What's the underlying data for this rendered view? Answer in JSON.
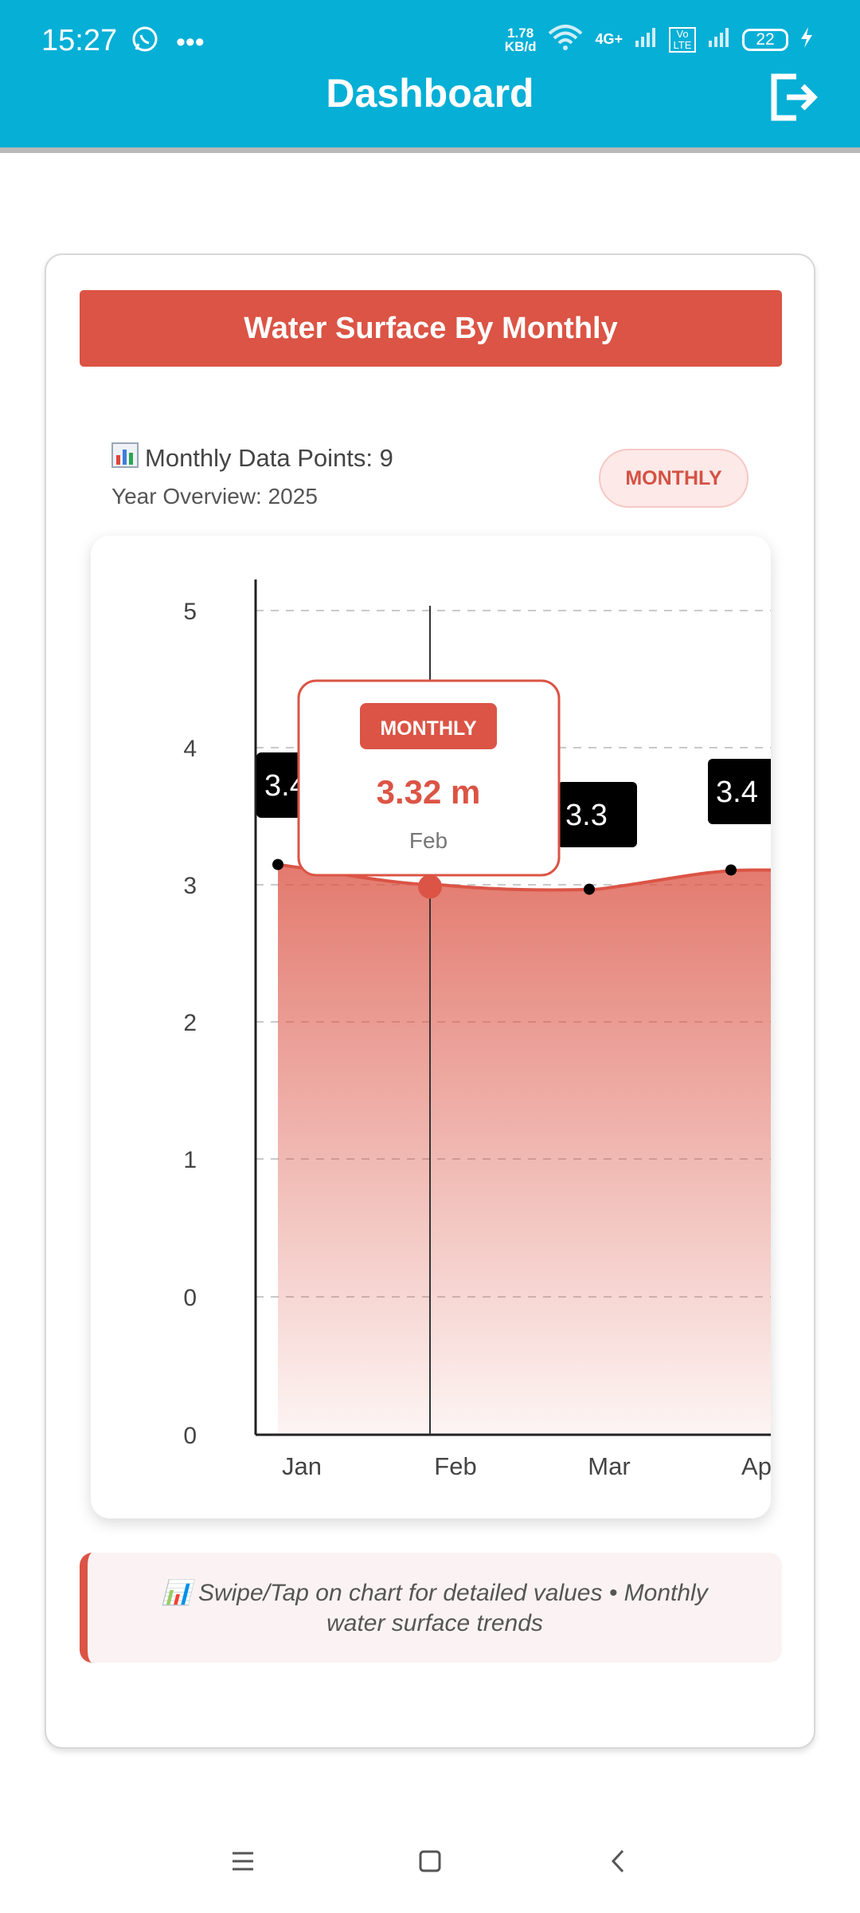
{
  "status": {
    "time": "15:27",
    "net_speed_top": "1.78",
    "net_speed_bottom": "KB/d",
    "network": "4G+",
    "volte": "Vo LTE",
    "battery": "22"
  },
  "header": {
    "title": "Dashboard"
  },
  "card": {
    "title": "Water Surface By Monthly",
    "data_points_label": "Monthly Data Points: 9",
    "year_overview": "Year Overview: 2025",
    "badge": "MONTHLY",
    "hint": "📊 Swipe/Tap on chart for detailed values • Monthly water surface trends"
  },
  "tooltip": {
    "badge": "MONTHLY",
    "value": "3.32 m",
    "month": "Feb"
  },
  "chart_data": {
    "type": "area",
    "categories": [
      "Jan",
      "Feb",
      "Mar",
      "Ap"
    ],
    "values": [
      3.15,
      3.0,
      2.97,
      3.11
    ],
    "data_labels": [
      "3.4",
      "",
      "3.3",
      "3.4"
    ],
    "y_ticks": [
      "5",
      "4",
      "3",
      "2",
      "1",
      "0",
      "0"
    ],
    "ylim": [
      0,
      5
    ],
    "grid": true,
    "color": "#DB5445",
    "selected_index": 1
  },
  "nav": {
    "menu_icon": "menu-icon",
    "home_icon": "home-icon",
    "back_icon": "back-icon"
  }
}
